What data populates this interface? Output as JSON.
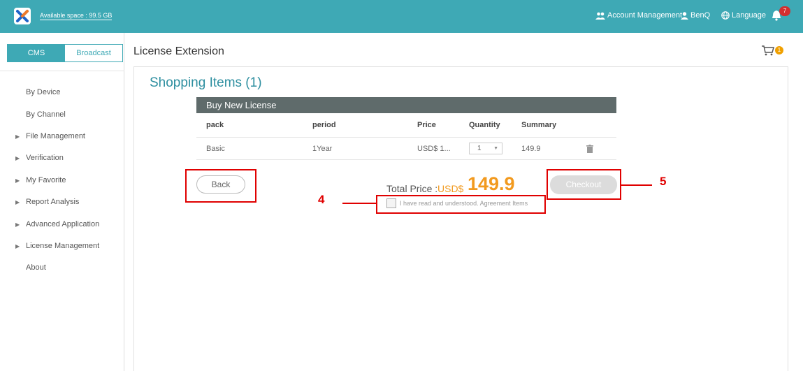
{
  "topbar": {
    "available_space": "Available space : 99.5 GB",
    "account_management": "Account Management",
    "user": "BenQ",
    "language": "Language",
    "notifications": "7"
  },
  "sidebar": {
    "switch": {
      "cms": "CMS",
      "broadcast": "Broadcast"
    },
    "items": [
      {
        "label": "By Device",
        "expandable": false
      },
      {
        "label": "By Channel",
        "expandable": false
      },
      {
        "label": "File Management",
        "expandable": true
      },
      {
        "label": "Verification",
        "expandable": true
      },
      {
        "label": "My Favorite",
        "expandable": true
      },
      {
        "label": "Report Analysis",
        "expandable": true
      },
      {
        "label": "Advanced Application",
        "expandable": true
      },
      {
        "label": "License Management",
        "expandable": true
      },
      {
        "label": "About",
        "expandable": false
      }
    ]
  },
  "header": {
    "title": "License Extension",
    "cart_count": "1"
  },
  "main": {
    "shopping_title": "Shopping Items (1)",
    "table": {
      "title": "Buy New License",
      "columns": [
        "pack",
        "period",
        "Price",
        "Quantity",
        "Summary"
      ],
      "rows": [
        {
          "pack": "Basic",
          "period": "1Year",
          "price": "USD$ 1...",
          "quantity": "1",
          "summary": "149.9"
        }
      ]
    },
    "back_label": "Back",
    "total_label": "Total Price :",
    "total_currency": "USD$",
    "total_value": "149.9",
    "checkout_label": "Checkout",
    "agreement_text": "I have read and understood. Agreement Items"
  },
  "annotations": {
    "label_4": "4",
    "label_5": "5"
  },
  "colors": {
    "accent": "#3ea9b5",
    "price": "#f29a1f",
    "highlight": "#e00000"
  }
}
